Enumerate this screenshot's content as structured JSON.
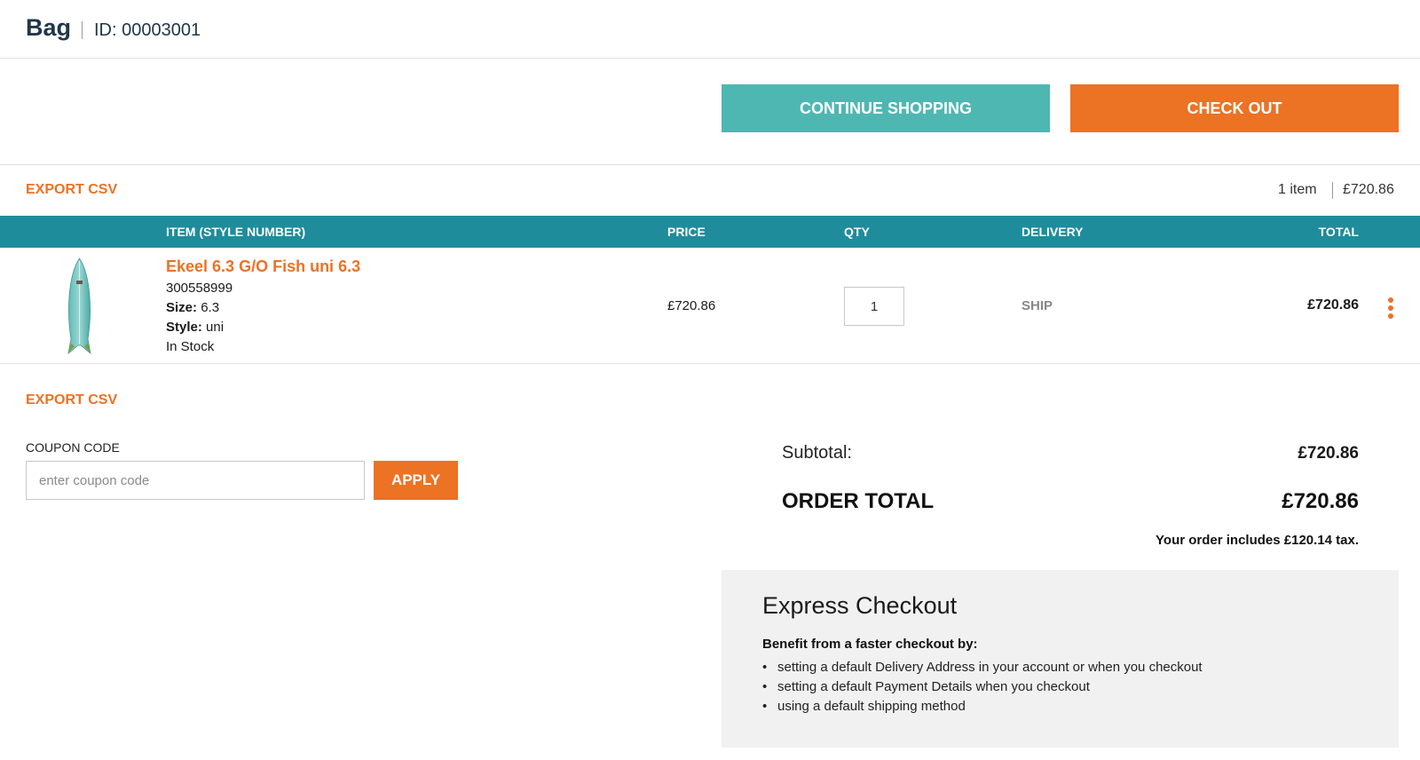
{
  "header": {
    "title": "Bag",
    "id_label": "ID: 00003001"
  },
  "actions": {
    "continue_shopping": "CONTINUE SHOPPING",
    "check_out": "CHECK OUT"
  },
  "toolbar": {
    "export_csv": "EXPORT CSV",
    "item_count": "1 item",
    "bag_total": "£720.86"
  },
  "table": {
    "columns": [
      "ITEM (STYLE NUMBER)",
      "PRICE",
      "QTY",
      "DELIVERY",
      "TOTAL"
    ],
    "rows": [
      {
        "name": "Ekeel 6.3 G/O Fish uni 6.3",
        "style_number": "300558999",
        "size_label": "Size:",
        "size": "6.3",
        "style_label": "Style:",
        "style": "uni",
        "stock": "In Stock",
        "price": "£720.86",
        "qty": "1",
        "delivery": "SHIP",
        "total": "£720.86",
        "image_icon": "surfboard-image"
      }
    ]
  },
  "footer_toolbar": {
    "export_csv": "EXPORT CSV"
  },
  "coupon": {
    "label": "COUPON CODE",
    "placeholder": "enter coupon code",
    "value": "",
    "apply_label": "APPLY"
  },
  "totals": {
    "subtotal_label": "Subtotal:",
    "subtotal_value": "£720.86",
    "order_total_label": "ORDER TOTAL",
    "order_total_value": "£720.86",
    "tax_note": "Your order includes £120.14 tax."
  },
  "express": {
    "title": "Express Checkout",
    "subtitle": "Benefit from a faster checkout by:",
    "items": [
      "setting a default Delivery Address in your account or when you checkout",
      "setting a default Payment Details when you checkout",
      "using a default shipping method"
    ]
  },
  "colors": {
    "accent_orange": "#ec7224",
    "teal_button": "#4fb7b2",
    "table_header": "#1f8c9c",
    "heading_navy": "#20364a",
    "panel_grey": "#f1f1f1"
  }
}
